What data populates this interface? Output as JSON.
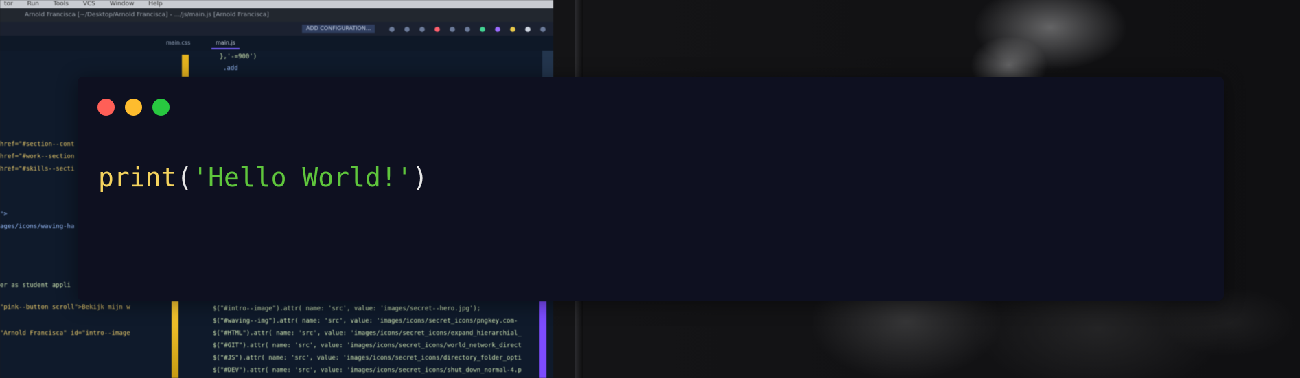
{
  "background": {
    "menubar_items": [
      "tor",
      "Run",
      "Tools",
      "VCS",
      "Window",
      "Help"
    ],
    "window_title": "Arnold Franciscа [~/Desktop/Arnold Franciscа] - .../js/main.js [Arnold Franciscа]",
    "toolbar_button": "ADD CONFIGURATION...",
    "tabs": [
      "main.css",
      "main.js"
    ],
    "code_lines_left": [
      "href=\"#section--cont",
      "href=\"#work--section",
      "href=\"#skills--secti",
      "\">",
      "ages/icons/waving-ha",
      "er as student appli",
      "\"pink--button scroll\">Bekijk mijn w",
      "\"Arnold Franciscа\" id=\"intro--image"
    ],
    "code_lines_right": [
      "},'-=900')",
      ".add",
      "$(\"#intro--image\").attr( name: 'src', value: 'images/secret--hero.jpg');",
      "$(\"#waving--img\").attr( name: 'src', value: 'images/icons/secret_icons/pngkey.com-",
      "$(\"#HTML\").attr( name: 'src', value: 'images/icons/secret_icons/expand_hierarchial_",
      "$(\"#GIT\").attr( name: 'src', value: 'images/icons/secret_icons/world_network_direct",
      "$(\"#JS\").attr( name: 'src', value: 'images/icons/secret_icons/directory_folder_opti",
      "$(\"#DEV\").attr( name: 'src', value: 'images/icons/secret_icons/shut_down_normal-4.p"
    ]
  },
  "terminal": {
    "window_controls": {
      "close_color": "#ff5f57",
      "minimize_color": "#febc2e",
      "maximize_color": "#28c840"
    },
    "code": {
      "function_name": "print",
      "open_paren": "(",
      "string_literal": "'Hello World!'",
      "close_paren": ")"
    },
    "colors": {
      "background": "#0e1020",
      "function": "#f4d35e",
      "string": "#5fc63c",
      "punctuation": "#e6e6e6"
    }
  }
}
